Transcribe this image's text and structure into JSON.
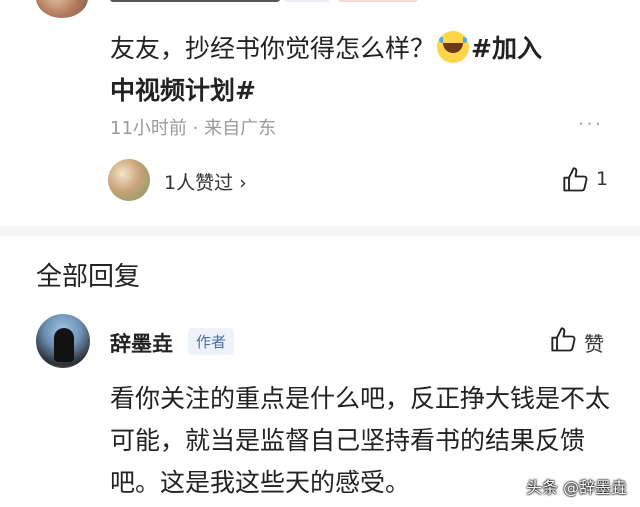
{
  "post": {
    "text_main": "友友，抄经书你觉得怎么样？",
    "emoji": "crying-laughing-face",
    "hashtag_line1": "#加入",
    "hashtag_line2": "中视频计划#",
    "time": "11小时前",
    "separator": "·",
    "location": "来自广东",
    "more": "···",
    "likers_text": "1人赞过 ›",
    "like_count": "1"
  },
  "replies_section": {
    "title": "全部回复"
  },
  "reply": {
    "name": "辞墨垚",
    "tag": "作者",
    "like_label": "赞",
    "text": "看你关注的重点是什么吧，反正挣大钱是不太可能，就当是监督自己坚持看书的结果反馈吧。这是我这些天的感受。"
  },
  "watermark": "头条 @辞墨垚"
}
